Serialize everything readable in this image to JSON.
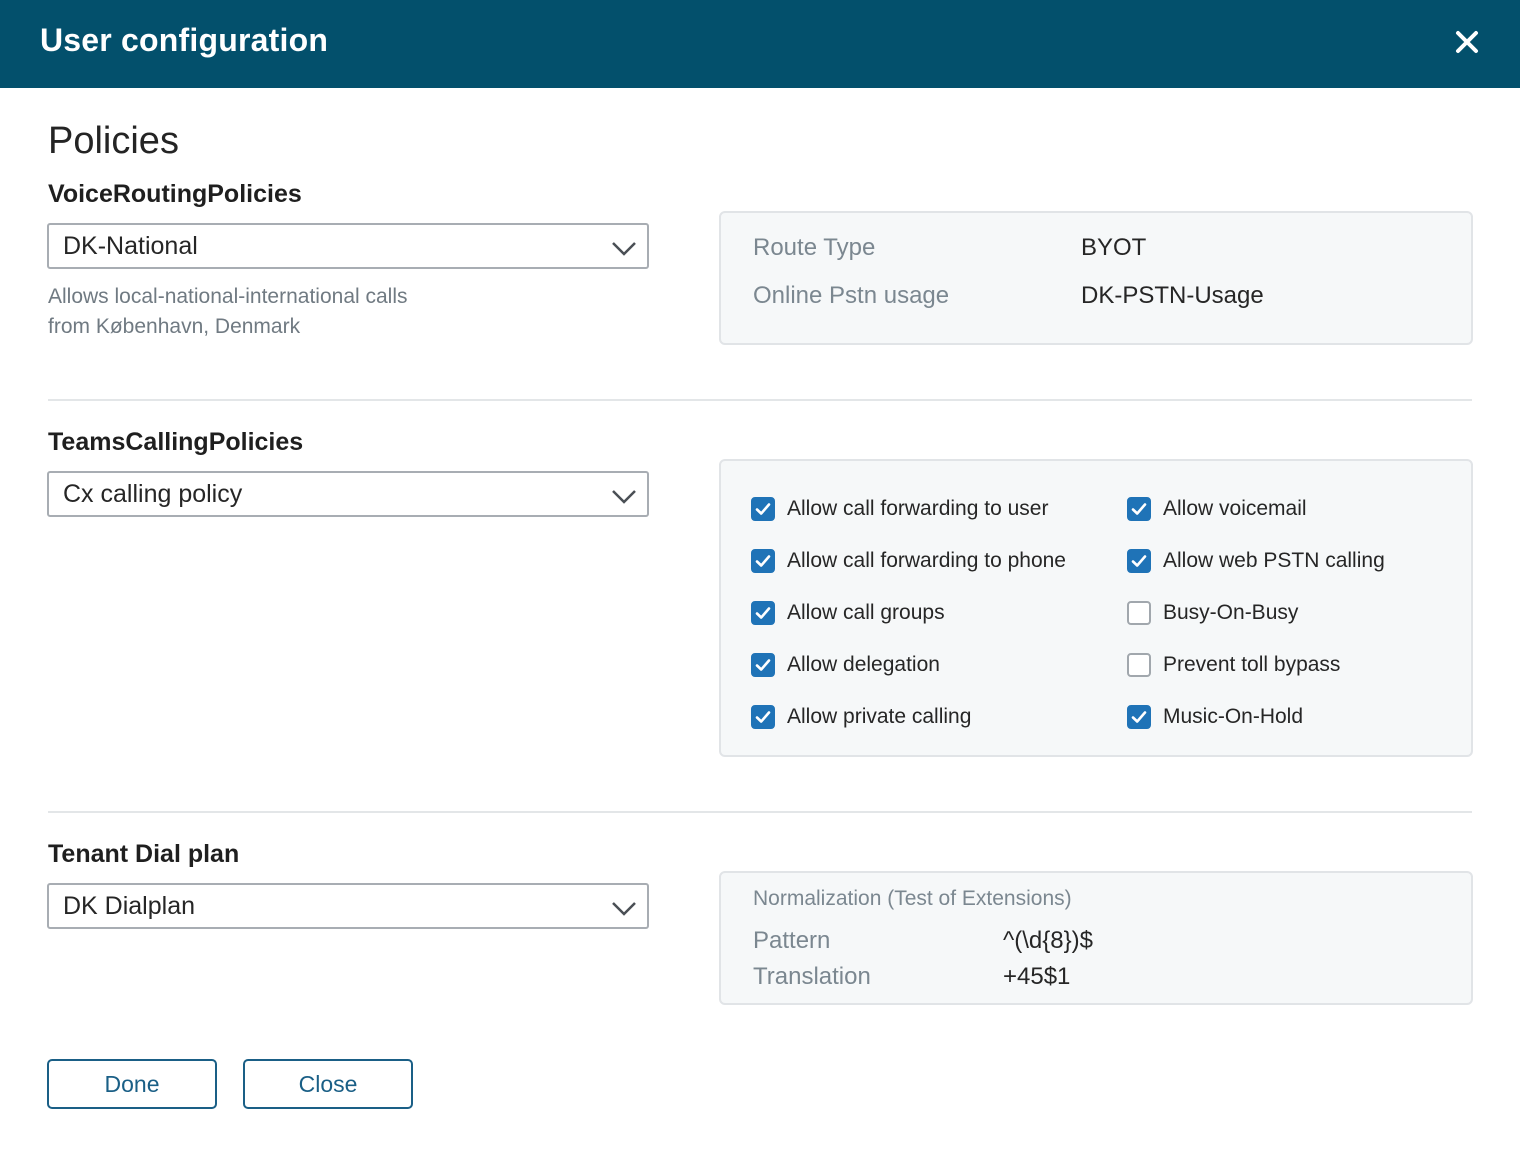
{
  "header": {
    "title": "User configuration"
  },
  "page": {
    "title": "Policies"
  },
  "voice_routing": {
    "label": "VoiceRoutingPolicies",
    "selected": "DK-National",
    "hint_line1": "Allows local-national-international calls",
    "hint_line2": "from København, Denmark",
    "details": [
      {
        "label": "Route Type",
        "value": "BYOT"
      },
      {
        "label": "Online Pstn usage",
        "value": "DK-PSTN-Usage"
      }
    ]
  },
  "teams_calling": {
    "label": "TeamsCallingPolicies",
    "selected": "Cx calling policy",
    "options": [
      {
        "label": "Allow call forwarding to user",
        "checked": true
      },
      {
        "label": "Allow voicemail",
        "checked": true
      },
      {
        "label": "Allow call forwarding to phone",
        "checked": true
      },
      {
        "label": "Allow web PSTN calling",
        "checked": true
      },
      {
        "label": "Allow call groups",
        "checked": true
      },
      {
        "label": "Busy-On-Busy",
        "checked": false
      },
      {
        "label": "Allow delegation",
        "checked": true
      },
      {
        "label": "Prevent toll bypass",
        "checked": false
      },
      {
        "label": "Allow private calling",
        "checked": true
      },
      {
        "label": "Music-On-Hold",
        "checked": true
      }
    ]
  },
  "dial_plan": {
    "label": "Tenant Dial plan",
    "selected": "DK Dialplan",
    "normalization_title": "Normalization (Test of Extensions)",
    "pattern_label": "Pattern",
    "pattern_value": "^(\\d{8})$",
    "translation_label": "Translation",
    "translation_value": "+45$1"
  },
  "buttons": {
    "done": "Done",
    "close": "Close"
  },
  "colors": {
    "header_bg": "#03506c",
    "checkbox": "#1f73b7",
    "button": "#1a5f86"
  }
}
